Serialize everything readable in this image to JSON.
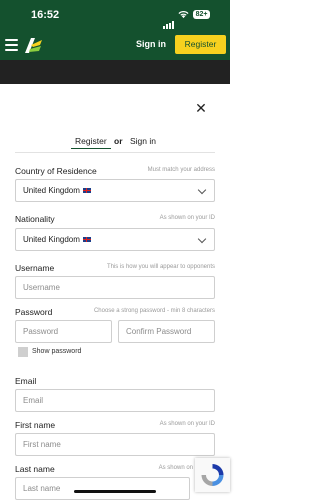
{
  "status_bar": {
    "time": "16:52",
    "battery": "82+"
  },
  "header": {
    "signin_label": "Sign in",
    "register_label": "Register"
  },
  "modal": {
    "close_glyph": "✕",
    "tabs": {
      "register": "Register",
      "or": "or",
      "signin": "Sign in"
    },
    "country": {
      "label": "Country of Residence",
      "hint": "Must match your address",
      "value": "United Kingdom"
    },
    "nationality": {
      "label": "Nationality",
      "hint": "As shown on your ID",
      "value": "United Kingdom"
    },
    "username": {
      "label": "Username",
      "hint": "This is how you will appear to opponents",
      "placeholder": "Username"
    },
    "password": {
      "label": "Password",
      "hint": "Choose a strong password - min 8 characters",
      "placeholder": "Password",
      "confirm_placeholder": "Confirm Password",
      "show_label": "Show password"
    },
    "email": {
      "label": "Email",
      "placeholder": "Email"
    },
    "first_name": {
      "label": "First name",
      "hint": "As shown on your ID",
      "placeholder": "First name"
    },
    "last_name": {
      "label": "Last name",
      "hint": "As shown on",
      "placeholder": "Last name"
    }
  },
  "colors": {
    "brand_green": "#14512e",
    "accent_yellow": "#f7d11f"
  },
  "icons": [
    "signal-icon",
    "wifi-icon",
    "battery-icon",
    "hamburger-icon",
    "logo-icon",
    "close-icon",
    "chevron-down-icon",
    "uk-flag-icon",
    "recaptcha-icon"
  ]
}
